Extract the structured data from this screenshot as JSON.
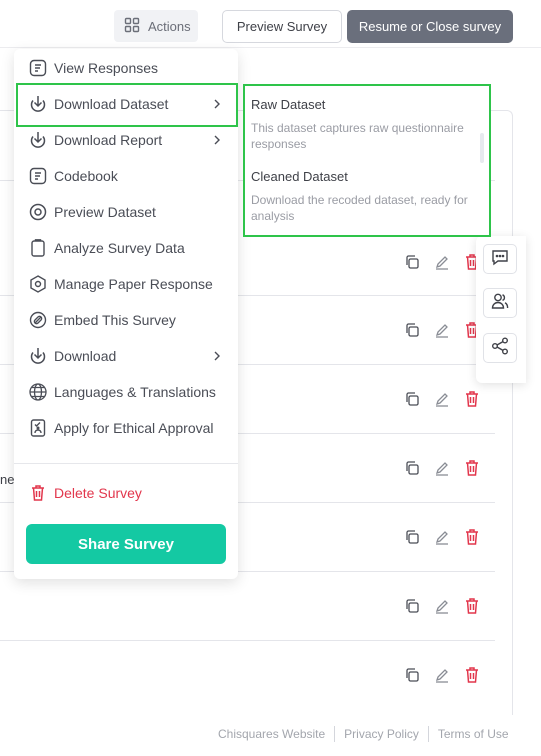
{
  "toolbar": {
    "actions_label": "Actions",
    "preview_label": "Preview Survey",
    "resume_label": "Resume or Close survey"
  },
  "menu": {
    "items": [
      {
        "label": "View Responses",
        "icon": "view-responses-icon"
      },
      {
        "label": "Download Dataset",
        "icon": "download-icon",
        "has_submenu": true
      },
      {
        "label": "Download Report",
        "icon": "download-icon",
        "has_submenu": true
      },
      {
        "label": "Codebook",
        "icon": "codebook-icon"
      },
      {
        "label": "Preview Dataset",
        "icon": "eye-icon"
      },
      {
        "label": "Analyze Survey Data",
        "icon": "clipboard-icon"
      },
      {
        "label": "Manage Paper Response",
        "icon": "hexagon-icon"
      },
      {
        "label": "Embed This Survey",
        "icon": "embed-icon"
      },
      {
        "label": "Download",
        "icon": "download-icon",
        "has_submenu": true
      },
      {
        "label": "Languages & Translations",
        "icon": "globe-icon"
      },
      {
        "label": "Apply for Ethical Approval",
        "icon": "approval-icon"
      }
    ],
    "delete_label": "Delete Survey",
    "share_label": "Share Survey"
  },
  "submenu": {
    "items": [
      {
        "title": "Raw Dataset",
        "description": "This dataset captures raw questionnaire responses"
      },
      {
        "title": "Cleaned Dataset",
        "description": "Download the recoded dataset, ready for analysis"
      }
    ]
  },
  "background": {
    "partial_text": "ne"
  },
  "footer": {
    "links": [
      "Chisquares Website",
      "Privacy Policy",
      "Terms of Use"
    ]
  },
  "colors": {
    "accent": "#14c9a3",
    "danger": "#e2364c",
    "highlight": "#2ec44a",
    "dark_button": "#6a6f7c"
  }
}
